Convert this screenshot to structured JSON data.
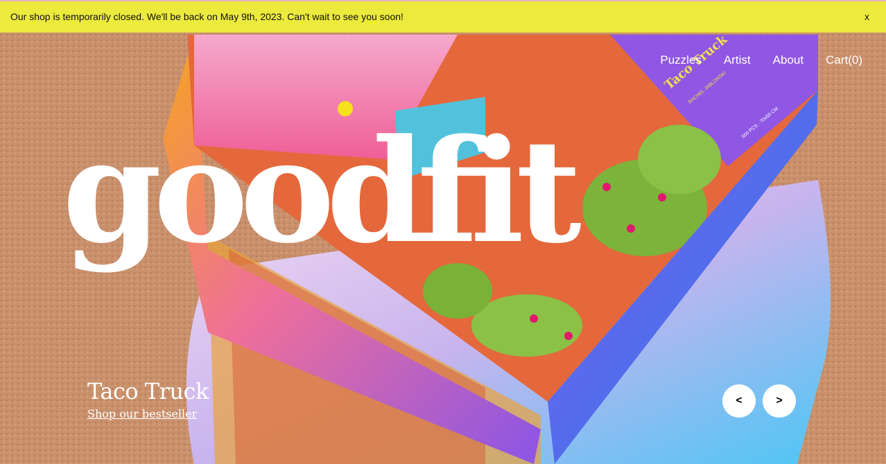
{
  "announcement": {
    "text": "Our shop is temporarily closed. We'll be back on May 9th, 2023. Can't wait to see you soon!",
    "close_label": "x"
  },
  "nav": {
    "items": [
      "Puzzles",
      "Artist",
      "About",
      "Cart(0)"
    ]
  },
  "brand": {
    "logo_text": "goodfit"
  },
  "hero": {
    "product_title": "Taco Truck",
    "cta_label": "Shop our bestseller",
    "prev_label": "<",
    "next_label": ">"
  },
  "box_art": {
    "title": "Taco Truck",
    "artist": "RACHEL JABLONSKI",
    "spec": "500 PCS · 70x50 CM"
  },
  "colors": {
    "announcement_bg": "#ecea3c",
    "text_on_hero": "#ffffff"
  }
}
